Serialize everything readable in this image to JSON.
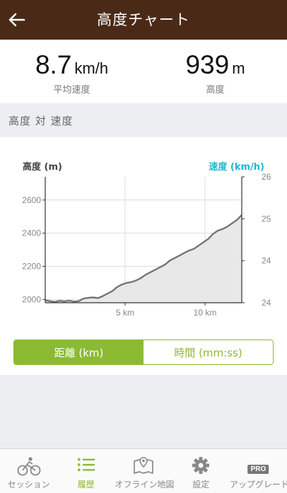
{
  "header": {
    "title": "高度チャート"
  },
  "stats": {
    "speed": {
      "value": "8.7",
      "unit": "km/h",
      "label": "平均速度"
    },
    "altitude": {
      "value": "939",
      "unit": "m",
      "label": "高度"
    }
  },
  "section": {
    "title": "高度 対 速度"
  },
  "toggle": {
    "distance": "距離 (km)",
    "time": "時間 (mm:ss)"
  },
  "colors": {
    "header": "#4a2a17",
    "accent": "#8cba32",
    "speed_axis": "#1fb6d3",
    "area": "#e8e8e8",
    "line": "#757575"
  },
  "tabs": [
    {
      "label": "セッション",
      "icon": "bike-icon"
    },
    {
      "label": "履歴",
      "icon": "list-icon"
    },
    {
      "label": "オフライン地図",
      "icon": "map-icon"
    },
    {
      "label": "設定",
      "icon": "gear-icon"
    },
    {
      "label": "アップグレード",
      "icon": "pro-icon",
      "badge": "PRO"
    }
  ],
  "chart_data": {
    "type": "area",
    "ylabel": "高度 (m)",
    "y2label": "速度 (km/h)",
    "xticks": [
      "5 km",
      "10 km"
    ],
    "xtick_values": [
      5,
      10
    ],
    "yticks": [
      "2000",
      "2200",
      "2400",
      "2600"
    ],
    "ytick_values": [
      2000,
      2200,
      2400,
      2600
    ],
    "y2ticks": [
      "24",
      "24",
      "25",
      "26"
    ],
    "xlim": [
      0,
      12.3
    ],
    "ylim": [
      1980,
      2740
    ],
    "series": [
      {
        "x": [
          0,
          0.3,
          0.6,
          0.9,
          1.2,
          1.5,
          1.8,
          2.1,
          2.4,
          2.7,
          3.0,
          3.3,
          3.6,
          3.9,
          4.2,
          4.5,
          4.8,
          5.1,
          5.4,
          5.7,
          6.0,
          6.3,
          6.6,
          6.9,
          7.2,
          7.5,
          7.8,
          8.1,
          8.4,
          8.7,
          9.0,
          9.3,
          9.6,
          9.9,
          10.2,
          10.5,
          10.8,
          11.1,
          11.4,
          11.7,
          12.0,
          12.3
        ],
        "y": [
          1995,
          1990,
          1985,
          1992,
          1988,
          1993,
          1987,
          1990,
          2005,
          2010,
          2012,
          2008,
          2020,
          2035,
          2050,
          2075,
          2090,
          2100,
          2105,
          2115,
          2130,
          2150,
          2165,
          2180,
          2195,
          2210,
          2235,
          2250,
          2265,
          2280,
          2295,
          2305,
          2325,
          2345,
          2365,
          2395,
          2415,
          2425,
          2440,
          2460,
          2480,
          2510
        ]
      }
    ],
    "grid": true
  }
}
